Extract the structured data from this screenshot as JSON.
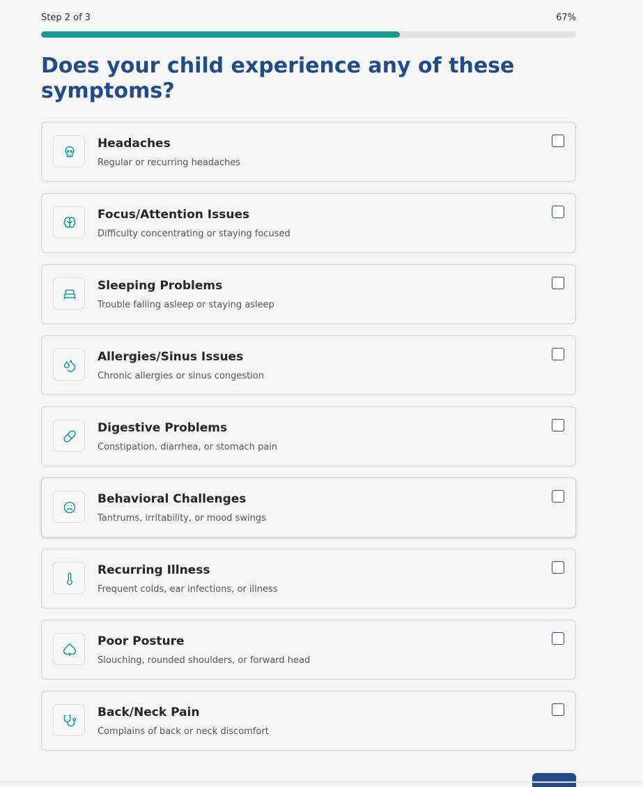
{
  "progress": {
    "step_label": "Step 2 of 3",
    "percent_label": "67%",
    "percent_value": 67
  },
  "question": {
    "title": "Does your child experience any of these symptoms?"
  },
  "options": [
    {
      "title": "Headaches",
      "description": "Regular or recurring headaches",
      "icon": "skull-icon",
      "checked": false
    },
    {
      "title": "Focus/Attention Issues",
      "description": "Difficulty concentrating or staying focused",
      "icon": "brain-icon",
      "checked": false
    },
    {
      "title": "Sleeping Problems",
      "description": "Trouble falling asleep or staying asleep",
      "icon": "bed-icon",
      "checked": false
    },
    {
      "title": "Allergies/Sinus Issues",
      "description": "Chronic allergies or sinus congestion",
      "icon": "droplets-icon",
      "checked": false
    },
    {
      "title": "Digestive Problems",
      "description": "Constipation, diarrhea, or stomach pain",
      "icon": "pill-icon",
      "checked": false
    },
    {
      "title": "Behavioral Challenges",
      "description": "Tantrums, irritability, or mood swings",
      "icon": "frown-icon",
      "checked": false
    },
    {
      "title": "Recurring Illness",
      "description": "Frequent colds, ear infections, or illness",
      "icon": "thermometer-icon",
      "checked": false
    },
    {
      "title": "Poor Posture",
      "description": "Slouching, rounded shoulders, or forward head",
      "icon": "spade-icon",
      "checked": false
    },
    {
      "title": "Back/Neck Pain",
      "description": "Complains of back or neck discomfort",
      "icon": "stethoscope-icon",
      "checked": false
    }
  ],
  "colors": {
    "accent": "#169a94",
    "heading": "#234b86",
    "track": "#e2e2e2"
  }
}
